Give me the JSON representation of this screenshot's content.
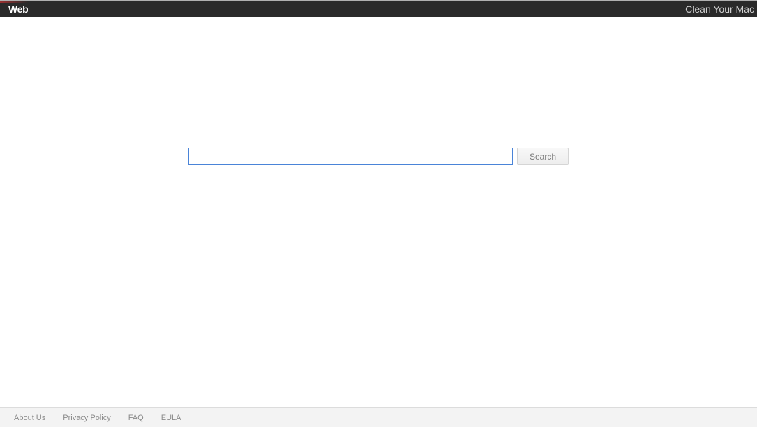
{
  "header": {
    "logo": "Web",
    "right_link": "Clean Your Mac"
  },
  "search": {
    "input_value": "",
    "input_placeholder": "",
    "button_label": "Search"
  },
  "footer": {
    "links": [
      "About Us",
      "Privacy Policy",
      "FAQ",
      "EULA"
    ]
  }
}
